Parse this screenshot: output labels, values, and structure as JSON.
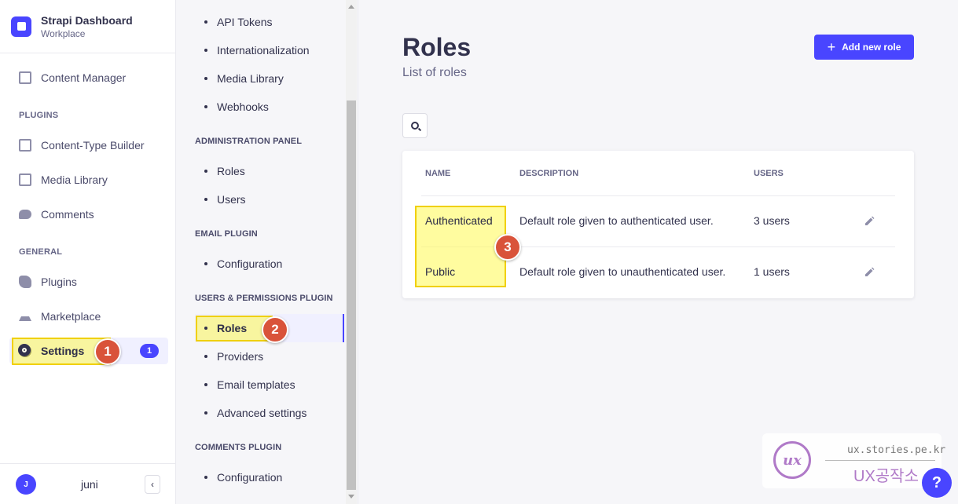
{
  "brand": {
    "title": "Strapi Dashboard",
    "subtitle": "Workplace"
  },
  "mainnav": {
    "content_manager": "Content Manager",
    "plugins_section": "PLUGINS",
    "content_type_builder": "Content-Type Builder",
    "media_library": "Media Library",
    "comments": "Comments",
    "general_section": "GENERAL",
    "plugins": "Plugins",
    "marketplace": "Marketplace",
    "settings": "Settings",
    "settings_badge": "1"
  },
  "footer": {
    "avatar_initial": "J",
    "user_name": "juni",
    "collapse_glyph": "‹"
  },
  "subnav": {
    "global_items": [
      "API Tokens",
      "Internationalization",
      "Media Library",
      "Webhooks"
    ],
    "admin_section": "ADMINISTRATION PANEL",
    "admin_items": [
      "Roles",
      "Users"
    ],
    "email_section": "EMAIL PLUGIN",
    "email_items": [
      "Configuration"
    ],
    "up_section": "USERS & PERMISSIONS PLUGIN",
    "up_items": [
      "Roles",
      "Providers",
      "Email templates",
      "Advanced settings"
    ],
    "comments_section": "COMMENTS PLUGIN",
    "comments_items": [
      "Configuration"
    ]
  },
  "page": {
    "title": "Roles",
    "subtitle": "List of roles",
    "add_button": "Add new role",
    "add_icon": "+"
  },
  "table": {
    "headers": {
      "name": "NAME",
      "description": "DESCRIPTION",
      "users": "USERS"
    },
    "rows": [
      {
        "name": "Authenticated",
        "description": "Default role given to authenticated user.",
        "users": "3 users"
      },
      {
        "name": "Public",
        "description": "Default role given to unauthenticated user.",
        "users": "1 users"
      }
    ]
  },
  "annotations": {
    "marker1": "1",
    "marker2": "2",
    "marker3": "3"
  },
  "watermark": {
    "logo": "ux",
    "url": "ux.stories.pe.kr",
    "brand": "UX공작소"
  },
  "help": {
    "label": "?"
  },
  "colors": {
    "accent": "#4945ff",
    "highlight": "#fff850",
    "marker": "#d9533a"
  }
}
